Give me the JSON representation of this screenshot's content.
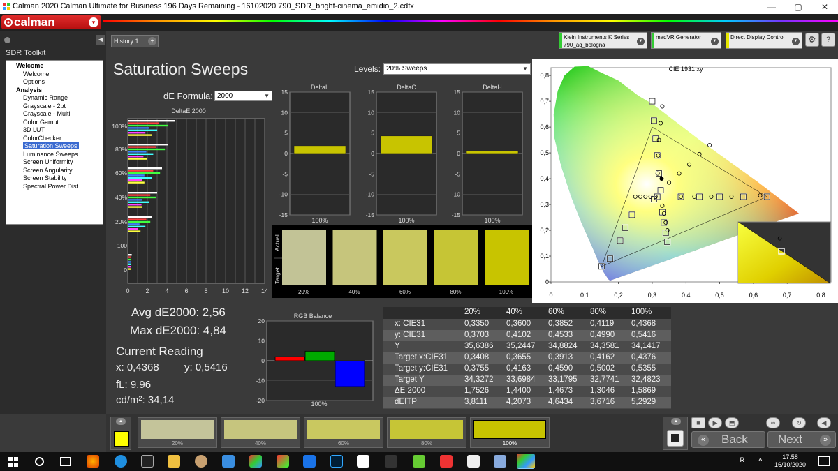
{
  "window": {
    "title": "Calman 2020 Calman Ultimate for Business 196 Days Remaining - 16102020 790_SDR_bright-cinema_emidio_2.cdfx",
    "minimize": "—",
    "maximize": "▢",
    "close": "✕"
  },
  "logo": {
    "text": "calman",
    "dropdown": "▾"
  },
  "sidebar": {
    "title": "SDR Toolkit",
    "collapse": "◀",
    "items": [
      {
        "label": "Welcome",
        "level": 0,
        "group": true
      },
      {
        "label": "Welcome",
        "level": 1
      },
      {
        "label": "Options",
        "level": 1
      },
      {
        "label": "Analysis",
        "level": 0,
        "group": true
      },
      {
        "label": "Dynamic Range",
        "level": 1
      },
      {
        "label": "Grayscale - 2pt",
        "level": 1
      },
      {
        "label": "Grayscale - Multi",
        "level": 1
      },
      {
        "label": "Color Gamut",
        "level": 1
      },
      {
        "label": "3D LUT",
        "level": 1
      },
      {
        "label": "ColorChecker",
        "level": 1
      },
      {
        "label": "Saturation Sweeps",
        "level": 1,
        "selected": true
      },
      {
        "label": "Luminance Sweeps",
        "level": 1
      },
      {
        "label": "Screen Uniformity",
        "level": 1
      },
      {
        "label": "Screen Angularity",
        "level": 1
      },
      {
        "label": "Screen Stability",
        "level": 1
      },
      {
        "label": "Spectral Power Dist.",
        "level": 1
      }
    ]
  },
  "header": {
    "history_tab": "History 1",
    "history_add": "+",
    "devices": [
      {
        "line1": "Klein Instruments K Series",
        "line2": "790_aq_bologna",
        "color": "#33cc33"
      },
      {
        "line1": "madVR Generator",
        "line2": "",
        "color": "#33cc33"
      },
      {
        "line1": "Direct Display Control",
        "line2": "",
        "color": "#e6e600"
      }
    ],
    "settings_icon": "⚙",
    "help_icon": "?"
  },
  "page": {
    "title": "Saturation Sweeps",
    "levels_label": "Levels:",
    "levels_value": "20% Sweeps",
    "de_formula_label": "dE Formula:",
    "de_formula_value": "2000",
    "avg_de": "Avg dE2000: 2,56",
    "max_de": "Max dE2000: 4,84",
    "current_reading_title": "Current Reading",
    "cur_x": "x: 0,4368",
    "cur_y": "y: 0,5416",
    "fl": "fL: 9,96",
    "cdm2": "cd/m²: 34,14"
  },
  "deltae_chart": {
    "title": "DeltaE 2000",
    "x_ticks": [
      "0",
      "2",
      "4",
      "6",
      "8",
      "10",
      "12",
      "14"
    ],
    "y_labels": [
      "100%",
      "80%",
      "60%",
      "40%",
      "20%",
      "100",
      "0"
    ],
    "bar_colors": [
      "#ffffff",
      "#ff4040",
      "#40ff40",
      "#4080ff",
      "#40ffff",
      "#ff40ff",
      "#ffff40"
    ],
    "group_values": [
      [
        4.8,
        3.2,
        4.1,
        2.2,
        3.0,
        1.8,
        2.5
      ],
      [
        4.1,
        2.9,
        3.8,
        1.9,
        2.6,
        1.6,
        2.0
      ],
      [
        3.5,
        2.6,
        3.3,
        1.7,
        2.5,
        1.5,
        1.7
      ],
      [
        3.0,
        2.3,
        2.9,
        1.5,
        2.2,
        1.4,
        1.5
      ],
      [
        2.5,
        1.9,
        2.3,
        1.2,
        1.8,
        1.0,
        1.3
      ],
      [
        0.4,
        0.3,
        0.3,
        0.3,
        0.3,
        0.3,
        0.3
      ]
    ],
    "xlim": [
      0,
      14
    ]
  },
  "delta_charts": [
    {
      "title": "DeltaL",
      "label": "100%",
      "value": 1.9,
      "yticks": [
        "15",
        "10",
        "5",
        "0",
        "-5",
        "-10",
        "-15"
      ]
    },
    {
      "title": "DeltaC",
      "label": "100%",
      "value": 4.3,
      "yticks": [
        "15",
        "10",
        "5",
        "0",
        "-5",
        "-10",
        "-15"
      ]
    },
    {
      "title": "DeltaH",
      "label": "100%",
      "value": 0.6,
      "yticks": [
        "15",
        "10",
        "5",
        "0",
        "-5",
        "-10",
        "-15"
      ]
    }
  ],
  "swatch_panel": {
    "actual_label": "Actual",
    "target_label": "Target",
    "items": [
      {
        "label": "20%",
        "actual": "#c2c396",
        "target": "#c2c396"
      },
      {
        "label": "40%",
        "actual": "#c6c57c",
        "target": "#c6c57c"
      },
      {
        "label": "60%",
        "actual": "#c9c85e",
        "target": "#c9c85e"
      },
      {
        "label": "80%",
        "actual": "#c6c535",
        "target": "#c6c535"
      },
      {
        "label": "100%",
        "actual": "#c8c400",
        "target": "#c8c400"
      }
    ]
  },
  "rgb_balance": {
    "title": "RGB Balance",
    "label": "100%",
    "yticks": [
      "20",
      "10",
      "0",
      "-10",
      "-20"
    ],
    "values": [
      {
        "channel": "R",
        "value": 2.0,
        "color": "#ff0000"
      },
      {
        "channel": "G",
        "value": 4.8,
        "color": "#00aa00"
      },
      {
        "channel": "B",
        "value": -13.0,
        "color": "#0000ff"
      }
    ],
    "ylim": [
      -20,
      20
    ]
  },
  "cie_chart": {
    "title": "CIE 1931 xy",
    "x_ticks": [
      "0",
      "0,1",
      "0,2",
      "0,3",
      "0,4",
      "0,5",
      "0,6",
      "0,7",
      "0,8"
    ],
    "y_ticks": [
      "0",
      "0,1",
      "0,2",
      "0,3",
      "0,4",
      "0,5",
      "0,6",
      "0,7",
      "0,8"
    ],
    "targets": [
      [
        0.15,
        0.06
      ],
      [
        0.175,
        0.09
      ],
      [
        0.205,
        0.16
      ],
      [
        0.22,
        0.21
      ],
      [
        0.24,
        0.26
      ],
      [
        0.3,
        0.7
      ],
      [
        0.305,
        0.625
      ],
      [
        0.31,
        0.555
      ],
      [
        0.315,
        0.49
      ],
      [
        0.32,
        0.42
      ],
      [
        0.64,
        0.33
      ],
      [
        0.57,
        0.33
      ],
      [
        0.5,
        0.33
      ],
      [
        0.44,
        0.33
      ],
      [
        0.385,
        0.33
      ],
      [
        0.33,
        0.27
      ],
      [
        0.335,
        0.23
      ],
      [
        0.34,
        0.19
      ],
      [
        0.345,
        0.155
      ],
      [
        0.305,
        0.32
      ],
      [
        0.315,
        0.33
      ],
      [
        0.325,
        0.355
      ]
    ],
    "measured": [
      [
        0.33,
        0.68
      ],
      [
        0.325,
        0.615
      ],
      [
        0.32,
        0.55
      ],
      [
        0.318,
        0.49
      ],
      [
        0.316,
        0.42
      ],
      [
        0.47,
        0.53
      ],
      [
        0.44,
        0.495
      ],
      [
        0.41,
        0.455
      ],
      [
        0.38,
        0.42
      ],
      [
        0.35,
        0.385
      ],
      [
        0.62,
        0.335
      ],
      [
        0.535,
        0.33
      ],
      [
        0.475,
        0.33
      ],
      [
        0.425,
        0.33
      ],
      [
        0.385,
        0.33
      ],
      [
        0.33,
        0.295
      ],
      [
        0.335,
        0.265
      ],
      [
        0.34,
        0.23
      ],
      [
        0.345,
        0.2
      ],
      [
        0.25,
        0.33
      ],
      [
        0.265,
        0.33
      ],
      [
        0.28,
        0.33
      ],
      [
        0.295,
        0.33
      ],
      [
        0.31,
        0.33
      ]
    ],
    "current": [
      0.328,
      0.4
    ],
    "inset_target": [
      0.4376,
      0.5355
    ],
    "inset_measured": [
      0.4368,
      0.5416
    ]
  },
  "table": {
    "headers": [
      "",
      "20%",
      "40%",
      "60%",
      "80%",
      "100%"
    ],
    "rows": [
      {
        "label": "x: CIE31",
        "values": [
          "0,3350",
          "0,3600",
          "0,3852",
          "0,4119",
          "0,4368"
        ]
      },
      {
        "label": "y: CIE31",
        "values": [
          "0,3703",
          "0,4102",
          "0,4533",
          "0,4990",
          "0,5416"
        ]
      },
      {
        "label": "Y",
        "values": [
          "35,6386",
          "35,2447",
          "34,8824",
          "34,3581",
          "34,1417"
        ]
      },
      {
        "label": "Target x:CIE31",
        "values": [
          "0,3408",
          "0,3655",
          "0,3913",
          "0,4162",
          "0,4376"
        ]
      },
      {
        "label": "Target y:CIE31",
        "values": [
          "0,3755",
          "0,4163",
          "0,4590",
          "0,5002",
          "0,5355"
        ]
      },
      {
        "label": "Target Y",
        "values": [
          "34,3272",
          "33,6984",
          "33,1795",
          "32,7741",
          "32,4823"
        ]
      },
      {
        "label": "ΔE 2000",
        "values": [
          "1,7526",
          "1,4400",
          "1,4673",
          "1,3046",
          "1,5869"
        ]
      },
      {
        "label": "dEITP",
        "values": [
          "3,8111",
          "4,2073",
          "4,6434",
          "3,6716",
          "5,2929"
        ]
      }
    ]
  },
  "bottom": {
    "current_color": "#ffff00",
    "swatches": [
      {
        "label": "20%",
        "color": "#c4c49a"
      },
      {
        "label": "40%",
        "color": "#c6c57e"
      },
      {
        "label": "60%",
        "color": "#c9c860"
      },
      {
        "label": "80%",
        "color": "#c6c536"
      },
      {
        "label": "100%",
        "color": "#c8c400"
      }
    ],
    "back_label": "Back",
    "next_label": "Next",
    "back_icon": "«",
    "next_icon": "»",
    "stop_icon": "■",
    "play_icon": "▶",
    "save_icon": "⬒",
    "loop_icon": "∞",
    "refresh_icon": "↻",
    "scroll_up_icon": "▲",
    "left_arrow_icon": "◀"
  },
  "taskbar": {
    "time": "17:58",
    "date": "16/10/2020",
    "user_icon": "ᴿ",
    "chevron": "^"
  }
}
